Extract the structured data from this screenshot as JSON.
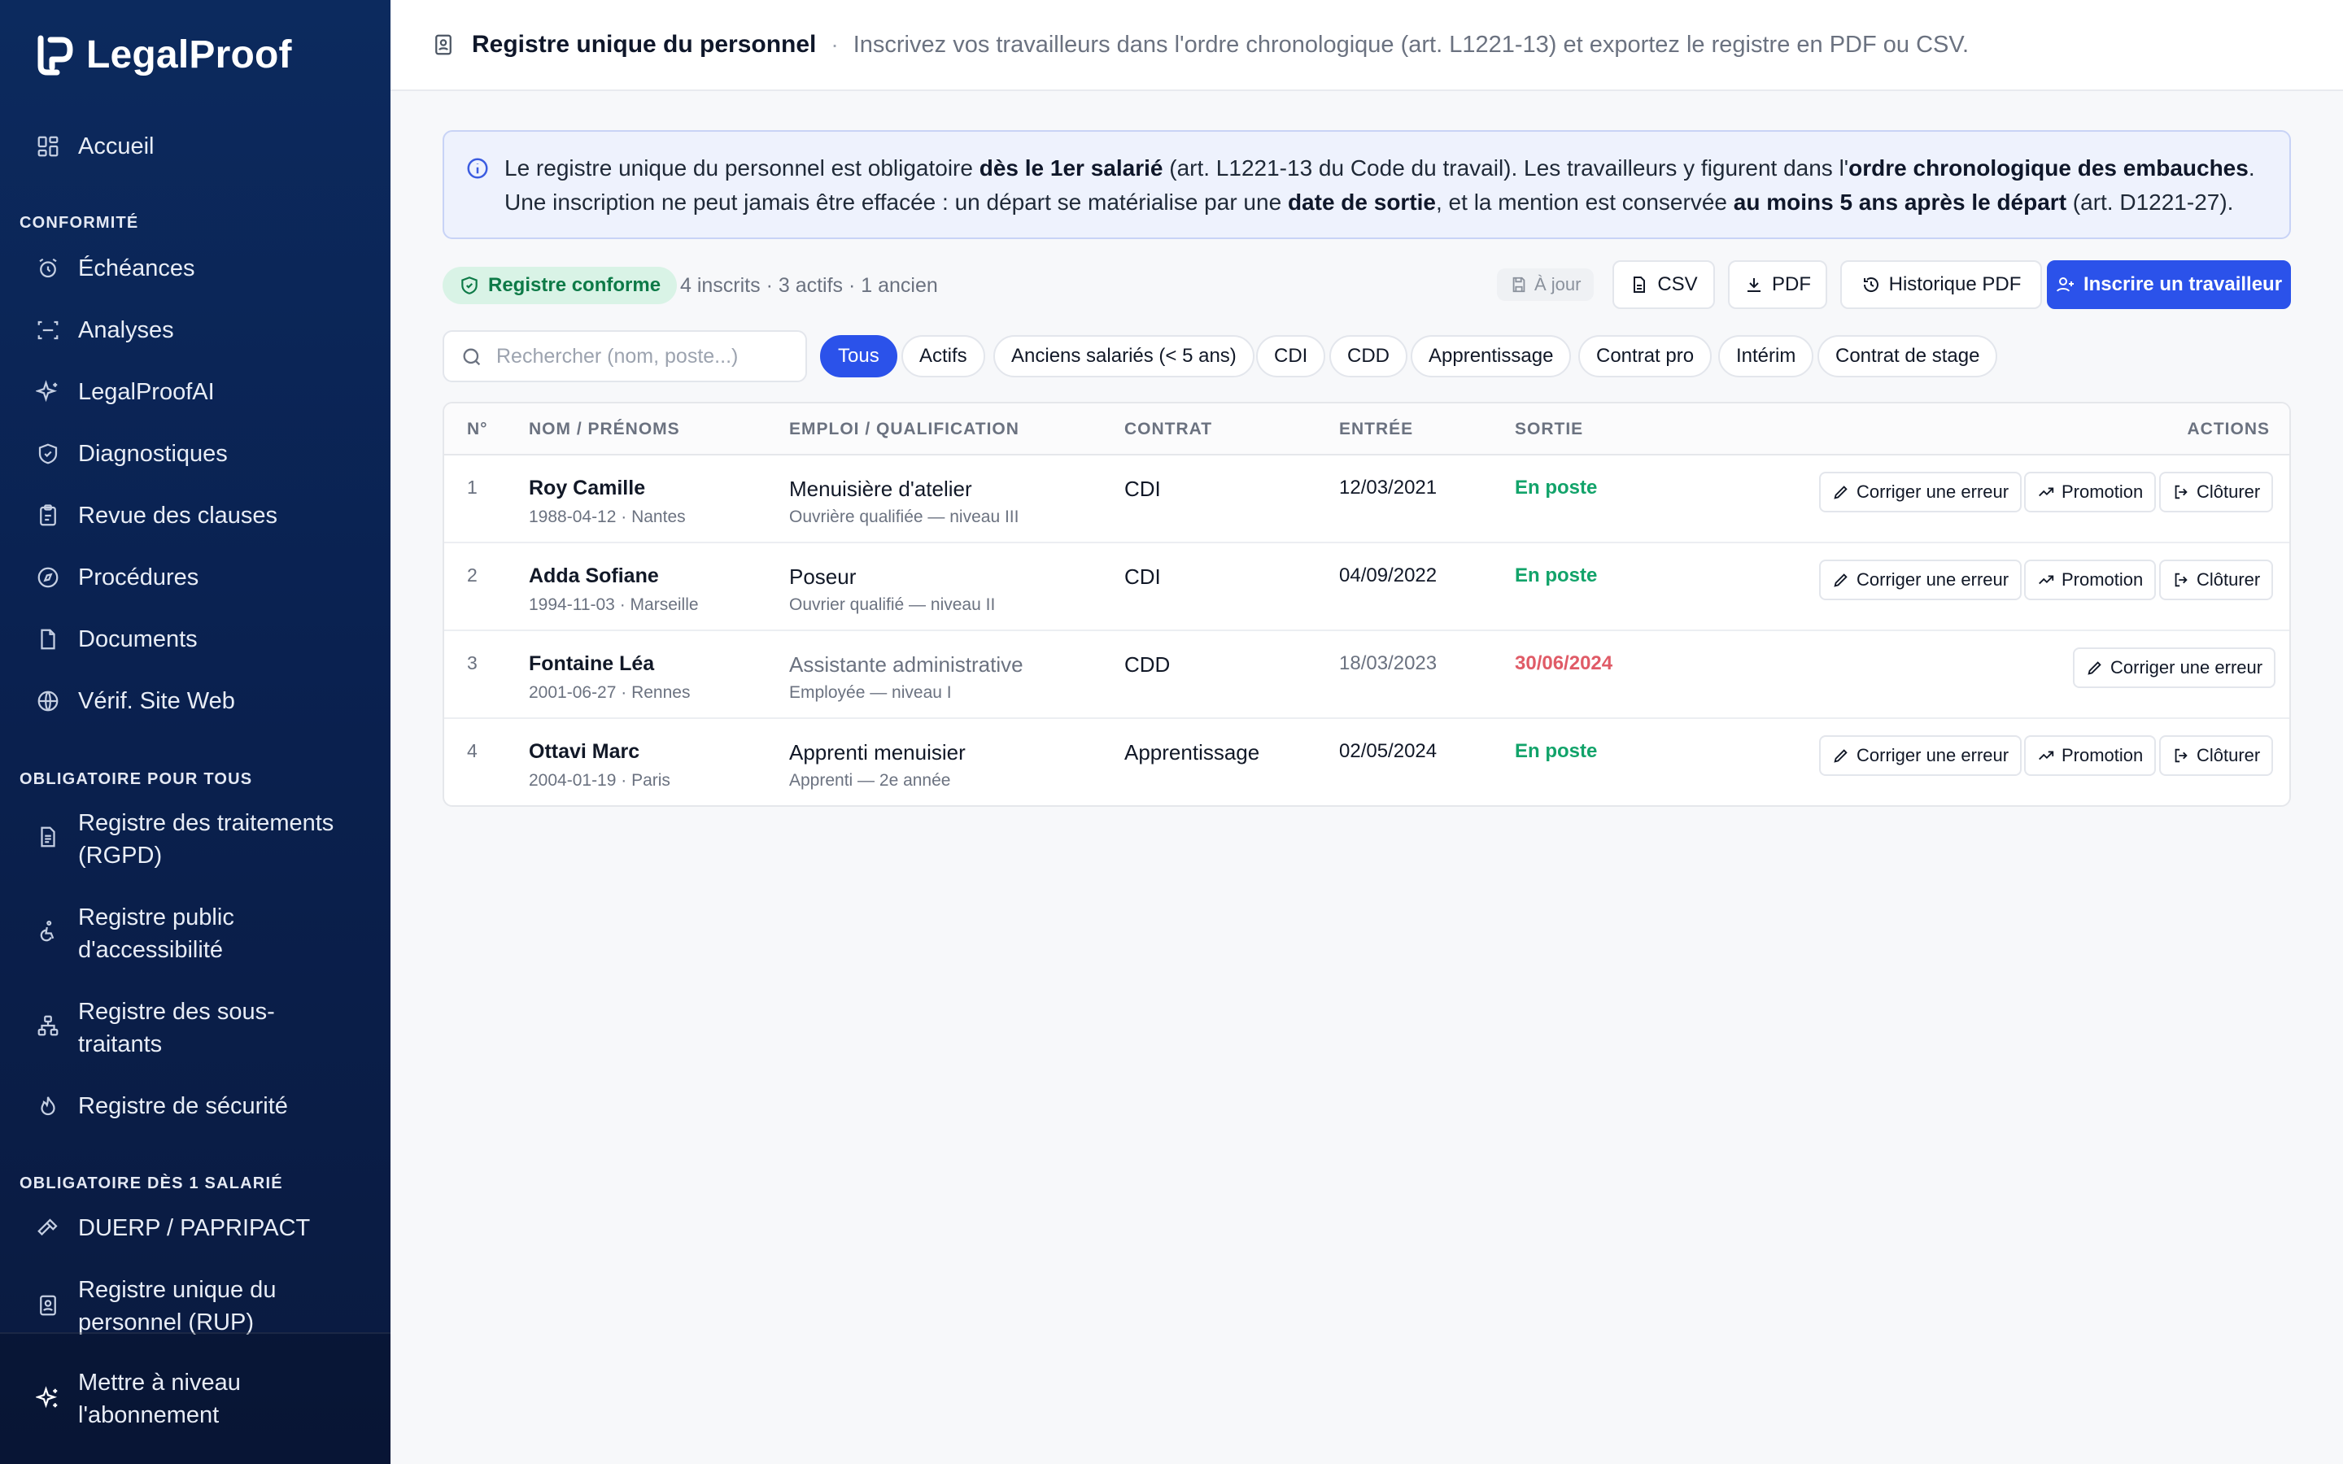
{
  "brand": {
    "name": "LegalProof"
  },
  "sidebar": {
    "home": {
      "label": "Accueil",
      "icon": "grid-icon"
    },
    "section_conformite": "CONFORMITÉ",
    "conformite_items": [
      {
        "label": "Échéances",
        "icon": "alarm-clock-icon"
      },
      {
        "label": "Analyses",
        "icon": "scan-icon"
      },
      {
        "label": "LegalProofAI",
        "icon": "sparkles-icon"
      },
      {
        "label": "Diagnostiques",
        "icon": "shield-check-icon"
      },
      {
        "label": "Revue des clauses",
        "icon": "clipboard-icon"
      },
      {
        "label": "Procédures",
        "icon": "compass-icon"
      },
      {
        "label": "Documents",
        "icon": "file-icon"
      },
      {
        "label": "Vérif. Site Web",
        "icon": "globe-icon"
      }
    ],
    "section_obligatoire": "OBLIGATOIRE POUR TOUS",
    "obligatoire_items": [
      {
        "line1": "Registre des traitements",
        "line2": "(RGPD)",
        "icon": "file-list-icon"
      },
      {
        "line1": "Registre public",
        "line2": "d'accessibilité",
        "icon": "accessibility-icon"
      },
      {
        "line1": "Registre des sous-",
        "line2": "traitants",
        "icon": "network-icon"
      },
      {
        "line1": "Registre de sécurité",
        "line2": "",
        "icon": "flame-icon"
      }
    ],
    "section_salarie": "OBLIGATOIRE DÈS 1 SALARIÉ",
    "salarie_items": [
      {
        "line1": "DUERP / PAPRIPACT",
        "line2": "",
        "icon": "hammer-icon"
      },
      {
        "line1": "Registre unique du",
        "line2": "personnel (RUP)",
        "icon": "id-badge-icon"
      }
    ],
    "upgrade": {
      "line1": "Mettre à niveau",
      "line2": "l'abonnement",
      "icon": "sparkles-icon"
    }
  },
  "header": {
    "title": "Registre unique du personnel",
    "separator": "·",
    "subtitle": "Inscrivez vos travailleurs dans l'ordre chronologique (art. L1221-13) et exportez le registre en PDF ou CSV."
  },
  "info": {
    "p1": "Le registre unique du personnel est obligatoire ",
    "b1": "dès le 1er salarié",
    "p2": " (art. L1221-13 du Code du travail). Les travailleurs y figurent dans l'",
    "b2": "ordre chronologique des embauches",
    "p3": ". Une inscription ne peut jamais être effacée : un départ se matérialise par une ",
    "b3": "date de sortie",
    "p4": ", et la mention est conservée ",
    "b4": "au moins 5 ans après le départ",
    "p5": " (art. D1221-27)."
  },
  "toolbar": {
    "status": "Registre conforme",
    "counts": "4 inscrits · 3 actifs · 1 ancien",
    "saved": "À jour",
    "csv": "CSV",
    "pdf": "PDF",
    "history": "Historique PDF",
    "add": "Inscrire un travailleur"
  },
  "search": {
    "placeholder": "Rechercher (nom, poste...)",
    "value": ""
  },
  "filters": [
    "Tous",
    "Actifs",
    "Anciens salariés (< 5 ans)",
    "CDI",
    "CDD",
    "Apprentissage",
    "Contrat pro",
    "Intérim",
    "Contrat de stage"
  ],
  "table": {
    "headers": {
      "num": "N°",
      "name": "NOM / PRÉNOMS",
      "job": "EMPLOI / QUALIFICATION",
      "contract": "CONTRAT",
      "entry": "ENTRÉE",
      "exit": "SORTIE",
      "actions": "ACTIONS"
    },
    "action_labels": {
      "fix": "Corriger une erreur",
      "promote": "Promotion",
      "close": "Clôturer"
    },
    "rows": [
      {
        "num": "1",
        "name": "Roy Camille",
        "meta": "1988-04-12 · Nantes",
        "job": "Menuisière d'atelier",
        "qual": "Ouvrière qualifiée — niveau III",
        "contract": "CDI",
        "entry": "12/03/2021",
        "exit": "En poste"
      },
      {
        "num": "2",
        "name": "Adda Sofiane",
        "meta": "1994-11-03 · Marseille",
        "job": "Poseur",
        "qual": "Ouvrier qualifié — niveau II",
        "contract": "CDI",
        "entry": "04/09/2022",
        "exit": "En poste"
      },
      {
        "num": "3",
        "name": "Fontaine Léa",
        "meta": "2001-06-27 · Rennes",
        "job": "Assistante administrative",
        "qual": "Employée — niveau I",
        "contract": "CDD",
        "entry": "18/03/2023",
        "exit": "30/06/2024"
      },
      {
        "num": "4",
        "name": "Ottavi Marc",
        "meta": "2004-01-19 · Paris",
        "job": "Apprenti menuisier",
        "qual": "Apprenti — 2e année",
        "contract": "Apprentissage",
        "entry": "02/05/2024",
        "exit": "En poste"
      }
    ]
  },
  "colors": {
    "accent": "#2b52ea",
    "success": "#12a36a",
    "danger": "#e05b67",
    "sidebar": "#0c2a5e"
  }
}
